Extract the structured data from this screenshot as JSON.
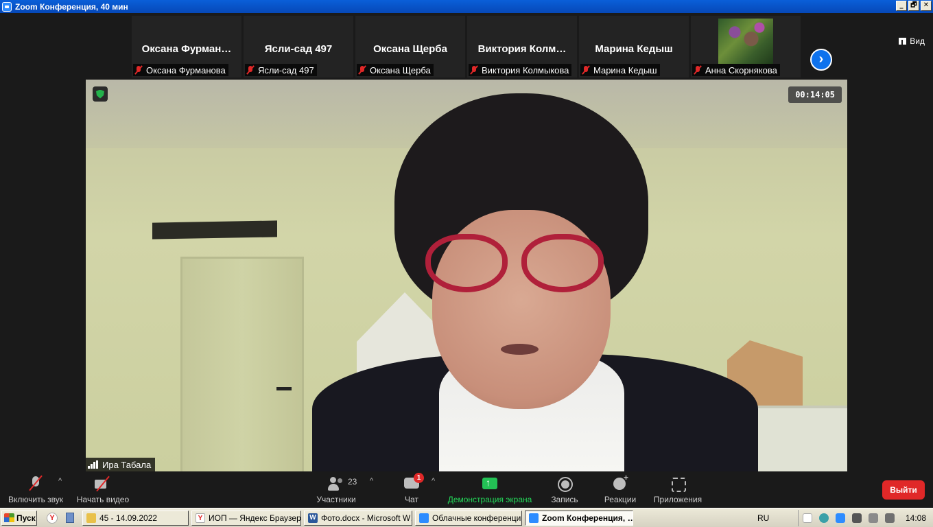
{
  "window": {
    "title": "Zoom Конференция, 40 мин",
    "buttons": [
      "_",
      "🗗",
      "✕"
    ]
  },
  "gallery": {
    "view_label": "Вид",
    "tiles": [
      {
        "display_name": "Оксана  Фурман…",
        "tag_name": "Оксана Фурманова",
        "muted": true,
        "has_photo": false
      },
      {
        "display_name": "Ясли-сад 497",
        "tag_name": "Ясли-сад 497",
        "muted": true,
        "has_photo": false
      },
      {
        "display_name": "Оксана Щерба",
        "tag_name": "Оксана Щерба",
        "muted": true,
        "has_photo": false
      },
      {
        "display_name": "Виктория  Колм…",
        "tag_name": "Виктория Колмыкова",
        "muted": true,
        "has_photo": false
      },
      {
        "display_name": "Марина Кедыш",
        "tag_name": "Марина Кедыш",
        "muted": true,
        "has_photo": false
      },
      {
        "display_name": "",
        "tag_name": "Анна Скорнякова",
        "muted": true,
        "has_photo": true
      }
    ],
    "next_icon": "chevron-right-icon"
  },
  "main_video": {
    "speaker_name": "Ира Табала",
    "timer": "00:14:05",
    "security_icon": "shield-check-icon"
  },
  "toolbar": {
    "unmute_label": "Включить звук",
    "video_label": "Начать видео",
    "participants_label": "Участники",
    "participants_count": "23",
    "chat_label": "Чат",
    "chat_badge": "1",
    "share_label": "Демонстрация экрана",
    "record_label": "Запись",
    "reactions_label": "Реакции",
    "apps_label": "Приложения",
    "leave_label": "Выйти",
    "share_color": "#23d959",
    "leave_color": "#e02828"
  },
  "taskbar": {
    "start_label": "Пуск",
    "tasks": [
      {
        "label": "45 - 14.09.2022",
        "icon": "folder-icon",
        "active": false
      },
      {
        "label": "ИОП — Яндекс Браузер",
        "icon": "yandex-icon",
        "active": false
      },
      {
        "label": "Фото.docx - Microsoft W…",
        "icon": "word-icon",
        "active": false
      },
      {
        "label": "Облачные конференци…",
        "icon": "zoom-icon",
        "active": false
      },
      {
        "label": "Zoom Конференция, …",
        "icon": "zoom-icon",
        "active": true
      }
    ],
    "lang": "RU",
    "clock": "14:08"
  }
}
